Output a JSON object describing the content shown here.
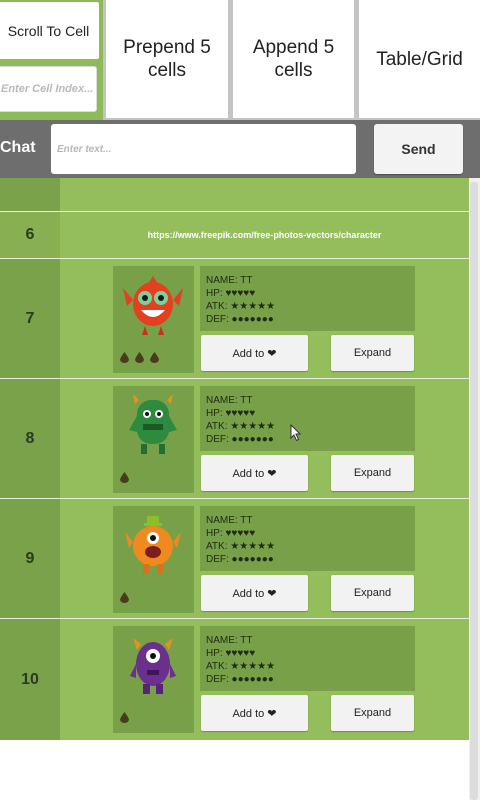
{
  "toolbar": {
    "scroll_to_cell_label": "Scroll To Cell",
    "cell_index_placeholder": "Enter Cell Index...",
    "prepend_line1": "Prepend 5",
    "prepend_line2": "cells",
    "append_line1": "Append 5",
    "append_line2": "cells",
    "table_grid_label": "Table/Grid"
  },
  "chat": {
    "label": "Chat",
    "placeholder": "Enter text...",
    "send_label": "Send"
  },
  "rows": [
    {
      "index": "6",
      "url": "https://www.freepik.com/free-photos-vectors/character"
    },
    {
      "index": "7",
      "monster": "red-monster",
      "drops": 3,
      "name": "NAME: TT",
      "hp": "HP: ♥♥♥♥♥",
      "atk": "ATK: ★★★★★",
      "def": "DEF: ●●●●●●●",
      "add_label": "Add to ❤",
      "expand_label": "Expand"
    },
    {
      "index": "8",
      "monster": "green-monster",
      "drops": 1,
      "name": "NAME: TT",
      "hp": "HP: ♥♥♥♥♥",
      "atk": "ATK: ★★★★★",
      "def": "DEF: ●●●●●●●",
      "add_label": "Add to ❤",
      "expand_label": "Expand"
    },
    {
      "index": "9",
      "monster": "orange-monster",
      "drops": 1,
      "name": "NAME: TT",
      "hp": "HP: ♥♥♥♥♥",
      "atk": "ATK: ★★★★★",
      "def": "DEF: ●●●●●●●",
      "add_label": "Add to ❤",
      "expand_label": "Expand"
    },
    {
      "index": "10",
      "monster": "purple-monster",
      "drops": 1,
      "name": "NAME: TT",
      "hp": "HP: ♥♥♥♥♥",
      "atk": "ATK: ★★★★★",
      "def": "DEF: ●●●●●●●",
      "add_label": "Add to ❤",
      "expand_label": "Expand"
    }
  ],
  "colors": {
    "list_bg": "#94be5c",
    "index_col": "#79a24a",
    "panel": "#77a049",
    "chat_bar": "#6e6e6e"
  }
}
